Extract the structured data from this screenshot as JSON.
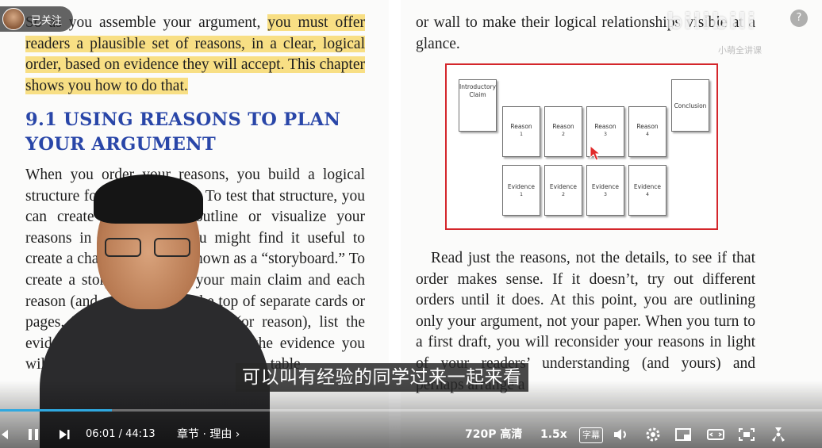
{
  "follow": {
    "label": "已关注"
  },
  "watermark": {
    "logo": "bilibili",
    "sub": "小萌全讲课"
  },
  "help_icon": "?",
  "book": {
    "left_intro": {
      "plain": "So as you assemble your argument, ",
      "highlight": "you must offer readers a plausible set of reasons, in a clear, logical order, based on evidence they will accept. This chapter shows you how to do that."
    },
    "heading": "9.1 USING REASONS TO PLAN YOUR ARGUMENT",
    "left_body": "When you order your reasons, you build a logical structure for your argument. To test that structure, you can create a traditional outline or visualize your reasons in other ways. You might find it useful to create a chart-like outline known as a “storyboard.” To create a storyboard, write your main claim and each reason (and subreasons) at the top of separate cards or pages. Then below each claim (or reason), list the evidence you have (or don’t have the evidence you will need). Then arrange the cards on a table",
    "right_top": "or wall to make their logical relationships visible at a glance.",
    "right_body": "Read just the reasons, not the details, to see if that order makes sense. If it doesn’t, try out different orders until it does. At this point, you are outlining only your argument, not your paper. When you turn to a first draft, you will reconsider your reasons in light of your readers’ understanding (and yours) and perhaps arrange a"
  },
  "diagram": {
    "intro": "Introductory Claim",
    "conclusion": "Conclusion",
    "reason_label": "Reason",
    "evidence_label": "Evidence",
    "numbers": [
      "1",
      "2",
      "3",
      "4"
    ]
  },
  "subtitle": "可以叫有经验的同学过来一起来看",
  "player": {
    "progress_fraction": 0.136,
    "time_current": "06:01",
    "time_sep": "/",
    "time_total": "44:13",
    "chapter": "章节 · 理由",
    "quality": "720P 高清",
    "speed": "1.5x",
    "cc": "字幕",
    "accent": "#2fa8e0"
  }
}
